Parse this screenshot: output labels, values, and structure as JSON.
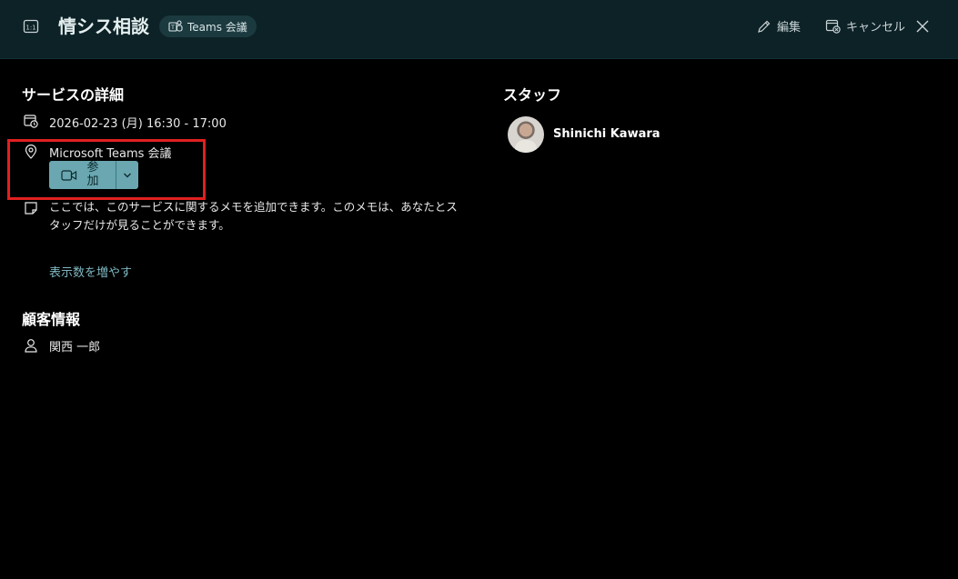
{
  "header": {
    "title": "情シス相談",
    "badge": "Teams 会議",
    "edit_label": "編集",
    "cancel_label": "キャンセル"
  },
  "service_details": {
    "heading": "サービスの詳細",
    "datetime": "2026-02-23 (月) 16:30 - 17:00",
    "location": "Microsoft Teams 会議",
    "join_label": "参加",
    "memo": "ここでは、このサービスに関するメモを追加できます。このメモは、あなたとスタッフだけが見ることができます。",
    "show_more": "表示数を増やす"
  },
  "customer": {
    "heading": "顧客情報",
    "name": "関西 一郎"
  },
  "staff": {
    "heading": "スタッフ",
    "name": "Shinichi Kawara"
  },
  "colors": {
    "header_bg": "#0c2226",
    "join_button": "#6aa7b0",
    "link": "#7fb8c2",
    "highlight": "#e02020"
  }
}
